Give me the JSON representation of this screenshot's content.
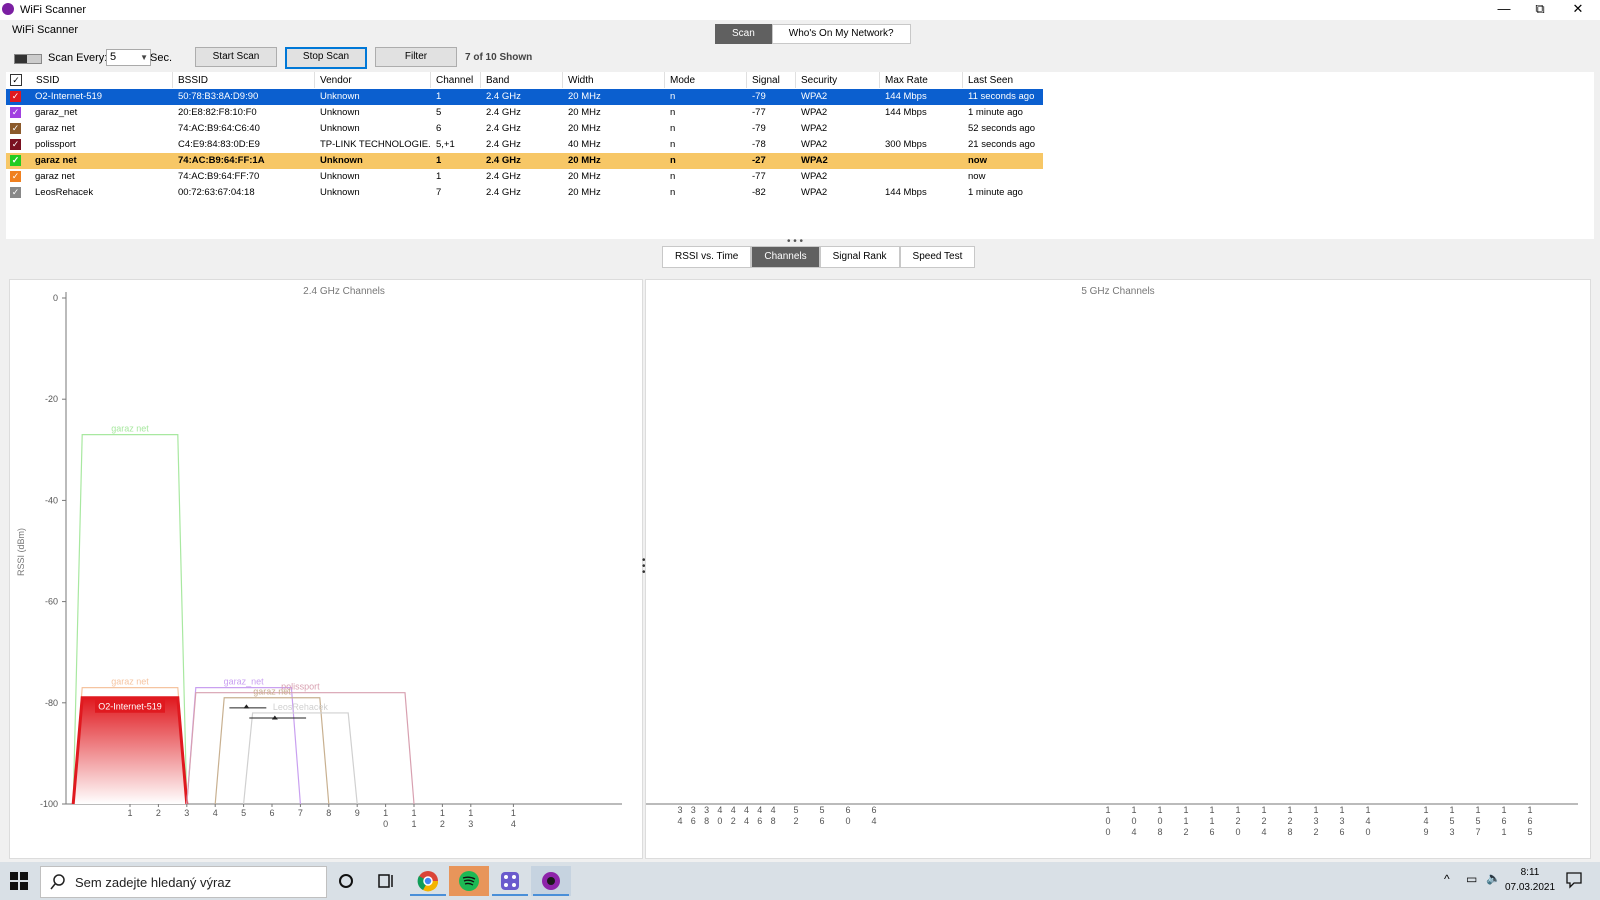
{
  "window": {
    "title": "WiFi Scanner",
    "subtitle": "WiFi Scanner",
    "minimize": "—",
    "restore": "⧉",
    "close": "✕"
  },
  "top_tabs": [
    "Scan",
    "Who's On My Network?"
  ],
  "toolbar": {
    "scan_every_label": "Scan Every:",
    "interval": "5",
    "sec_label": "Sec.",
    "start_scan": "Start Scan",
    "stop_scan": "Stop Scan",
    "filter": "Filter",
    "shown": "7 of 10 Shown"
  },
  "table": {
    "headers": [
      "SSID",
      "BSSID",
      "Vendor",
      "Channel",
      "Band",
      "Width",
      "Mode",
      "Signal",
      "Security",
      "Max Rate",
      "Last Seen"
    ],
    "rows": [
      {
        "color": "#e0191f",
        "state": "selected",
        "ssid": "O2-Internet-519",
        "bssid": "50:78:B3:8A:D9:90",
        "vendor": "Unknown",
        "channel": "1",
        "band": "2.4 GHz",
        "width": "20 MHz",
        "mode": "n",
        "signal": "-79",
        "security": "WPA2",
        "max_rate": "144 Mbps",
        "last_seen": "11 seconds ago"
      },
      {
        "color": "#a040e0",
        "state": "",
        "ssid": "garaz_net",
        "bssid": "20:E8:82:F8:10:F0",
        "vendor": "Unknown",
        "channel": "5",
        "band": "2.4 GHz",
        "width": "20 MHz",
        "mode": "n",
        "signal": "-77",
        "security": "WPA2",
        "max_rate": "144 Mbps",
        "last_seen": "1 minute ago"
      },
      {
        "color": "#8b5a2b",
        "state": "",
        "ssid": "garaz net",
        "bssid": "74:AC:B9:64:C6:40",
        "vendor": "Unknown",
        "channel": "6",
        "band": "2.4 GHz",
        "width": "20 MHz",
        "mode": "n",
        "signal": "-79",
        "security": "WPA2",
        "max_rate": "",
        "last_seen": "52 seconds ago"
      },
      {
        "color": "#7a1020",
        "state": "",
        "ssid": "polissport",
        "bssid": "C4:E9:84:83:0D:E9",
        "vendor": "TP-LINK TECHNOLOGIE...",
        "channel": "5,+1",
        "band": "2.4 GHz",
        "width": "40 MHz",
        "mode": "n",
        "signal": "-78",
        "security": "WPA2",
        "max_rate": "300 Mbps",
        "last_seen": "21 seconds ago"
      },
      {
        "color": "#22cc22",
        "state": "highlight",
        "ssid": "garaz net",
        "bssid": "74:AC:B9:64:FF:1A",
        "vendor": "Unknown",
        "channel": "1",
        "band": "2.4 GHz",
        "width": "20 MHz",
        "mode": "n",
        "signal": "-27",
        "security": "WPA2",
        "max_rate": "",
        "last_seen": "now"
      },
      {
        "color": "#f08020",
        "state": "",
        "ssid": "garaz net",
        "bssid": "74:AC:B9:64:FF:70",
        "vendor": "Unknown",
        "channel": "1",
        "band": "2.4 GHz",
        "width": "20 MHz",
        "mode": "n",
        "signal": "-77",
        "security": "WPA2",
        "max_rate": "",
        "last_seen": "now"
      },
      {
        "color": "#888888",
        "state": "",
        "ssid": "LeosRehacek",
        "bssid": "00:72:63:67:04:18",
        "vendor": "Unknown",
        "channel": "7",
        "band": "2.4 GHz",
        "width": "20 MHz",
        "mode": "n",
        "signal": "-82",
        "security": "WPA2",
        "max_rate": "144 Mbps",
        "last_seen": "1 minute ago"
      }
    ]
  },
  "bottom_tabs": [
    "RSSI vs. Time",
    "Channels",
    "Signal Rank",
    "Speed Test"
  ],
  "chart_data": [
    {
      "type": "area",
      "title": "2.4 GHz Channels",
      "ylabel": "RSSI (dBm)",
      "ylim": [
        -100,
        0
      ],
      "yticks": [
        0,
        -20,
        -40,
        -60,
        -80,
        -100
      ],
      "xticks": [
        "1",
        "2",
        "3",
        "4",
        "5",
        "6",
        "7",
        "8",
        "9",
        "10",
        "11",
        "12",
        "13",
        "14"
      ],
      "series": [
        {
          "name": "garaz net",
          "color": "#a8e8a0",
          "start": -1,
          "end": 3,
          "rssi": -27,
          "fill": false
        },
        {
          "name": "garaz net",
          "color": "#f5c4a0",
          "start": -1,
          "end": 3,
          "rssi": -77,
          "fill": false
        },
        {
          "name": "O2-Internet-519",
          "color": "#e0191f",
          "start": -1,
          "end": 3,
          "rssi": -79,
          "fill": true
        },
        {
          "name": "garaz_net",
          "color": "#c9a0f0",
          "start": 3,
          "end": 7,
          "rssi": -77,
          "fill": false
        },
        {
          "name": "polissport",
          "color": "#d8a0b0",
          "start": 3,
          "end": 11,
          "rssi": -78,
          "fill": false
        },
        {
          "name": "garaz net",
          "color": "#c8b090",
          "start": 4,
          "end": 8,
          "rssi": -79,
          "fill": false
        },
        {
          "name": "LeosRehacek",
          "color": "#d0d0d0",
          "start": 5,
          "end": 9,
          "rssi": -82,
          "fill": false
        }
      ]
    },
    {
      "type": "area",
      "title": "5 GHz Channels",
      "xticks": [
        "34",
        "36",
        "38",
        "40",
        "42",
        "44",
        "46",
        "48",
        "52",
        "56",
        "60",
        "64",
        "100",
        "104",
        "108",
        "112",
        "116",
        "120",
        "124",
        "128",
        "132",
        "136",
        "140",
        "149",
        "153",
        "157",
        "161",
        "165"
      ]
    }
  ],
  "taskbar": {
    "search_placeholder": "Sem zadejte hledaný výraz",
    "time": "8:11",
    "date": "07.03.2021"
  }
}
